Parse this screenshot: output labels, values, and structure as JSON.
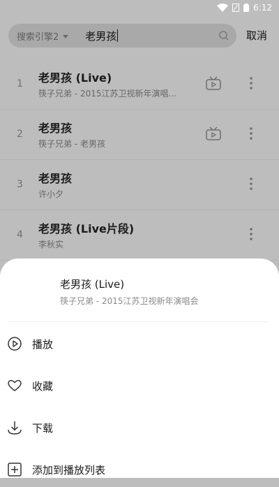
{
  "status_bar": {
    "time": "6:12"
  },
  "search": {
    "engine_label": "搜索引擎2",
    "query": "老男孩",
    "cancel_label": "取消"
  },
  "results": [
    {
      "index": "1",
      "title": "老男孩 (Live)",
      "subtitle": "筷子兄弟 - 2015江苏卫视新年演唱...",
      "has_mv": true
    },
    {
      "index": "2",
      "title": "老男孩",
      "subtitle": "筷子兄弟 - 老男孩",
      "has_mv": true
    },
    {
      "index": "3",
      "title": "老男孩",
      "subtitle": "许小夕",
      "has_mv": false
    },
    {
      "index": "4",
      "title": "老男孩 (Live片段)",
      "subtitle": "李秋实",
      "has_mv": false
    }
  ],
  "sheet": {
    "title": "老男孩 (Live)",
    "subtitle": "筷子兄弟 - 2015江苏卫视新年演唱会",
    "actions": [
      {
        "label": "播放",
        "icon": "play-circle-icon"
      },
      {
        "label": "收藏",
        "icon": "heart-icon"
      },
      {
        "label": "下载",
        "icon": "download-icon"
      },
      {
        "label": "添加到播放列表",
        "icon": "add-to-playlist-icon"
      }
    ]
  }
}
